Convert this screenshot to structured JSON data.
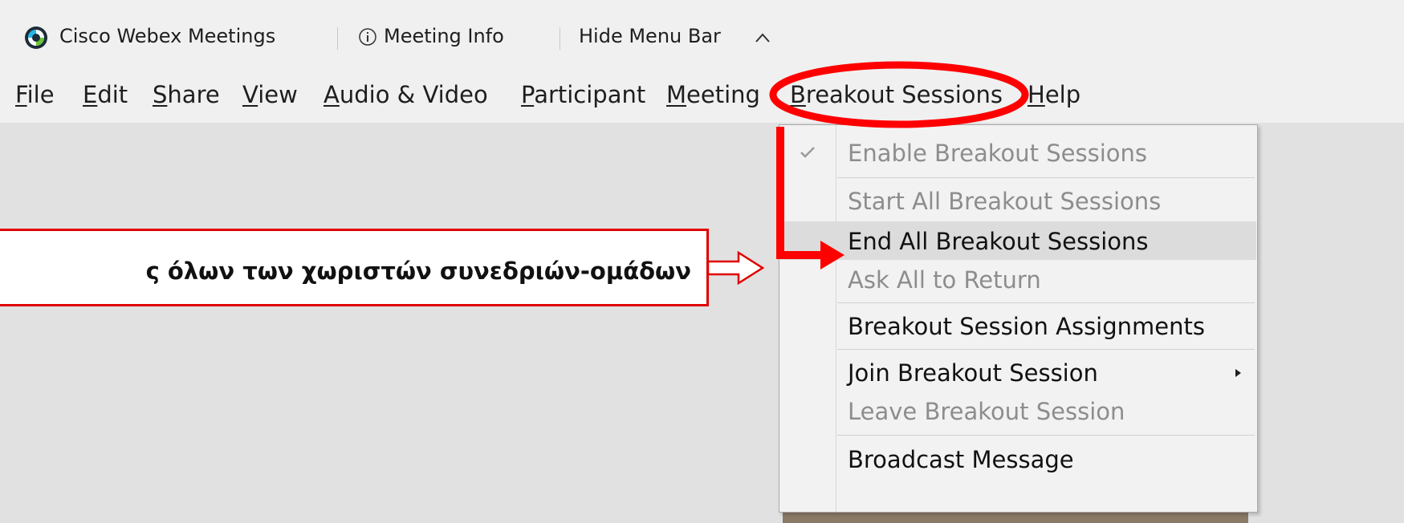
{
  "titlebar": {
    "app_name": "Cisco Webex Meetings",
    "meeting_info": "Meeting Info",
    "hide_menu_bar": "Hide Menu Bar"
  },
  "menubar": {
    "items": [
      {
        "label": "File",
        "accel": "F"
      },
      {
        "label": "Edit",
        "accel": "E"
      },
      {
        "label": "Share",
        "accel": "S"
      },
      {
        "label": "View",
        "accel": "V"
      },
      {
        "label": "Audio & Video",
        "accel": "A"
      },
      {
        "label": "Participant",
        "accel": "P"
      },
      {
        "label": "Meeting",
        "accel": "M"
      },
      {
        "label": "Breakout Sessions",
        "accel": "B"
      },
      {
        "label": "Help",
        "accel": "H"
      }
    ]
  },
  "dropdown": {
    "items": [
      {
        "label": "Enable Breakout Sessions",
        "checked": true,
        "enabled": false
      },
      {
        "label": "Start All Breakout Sessions",
        "enabled": false
      },
      {
        "label": "End All Breakout Sessions",
        "enabled": true,
        "highlighted": true
      },
      {
        "label": "Ask All to Return",
        "enabled": false
      },
      {
        "label": "Breakout Session Assignments",
        "enabled": true
      },
      {
        "label": "Join Breakout Session",
        "enabled": true,
        "submenu": true
      },
      {
        "label": "Leave Breakout Session",
        "enabled": false
      },
      {
        "label": "Broadcast Message",
        "enabled": true
      }
    ]
  },
  "callout": {
    "text": "ς όλων των χωριστών συνεδριών-ομάδων"
  },
  "colors": {
    "annotation_red": "#ff0000",
    "menu_bg": "#f0f0f0",
    "highlight_bg": "#dcdcdc",
    "disabled_text": "#8d8d8d"
  }
}
